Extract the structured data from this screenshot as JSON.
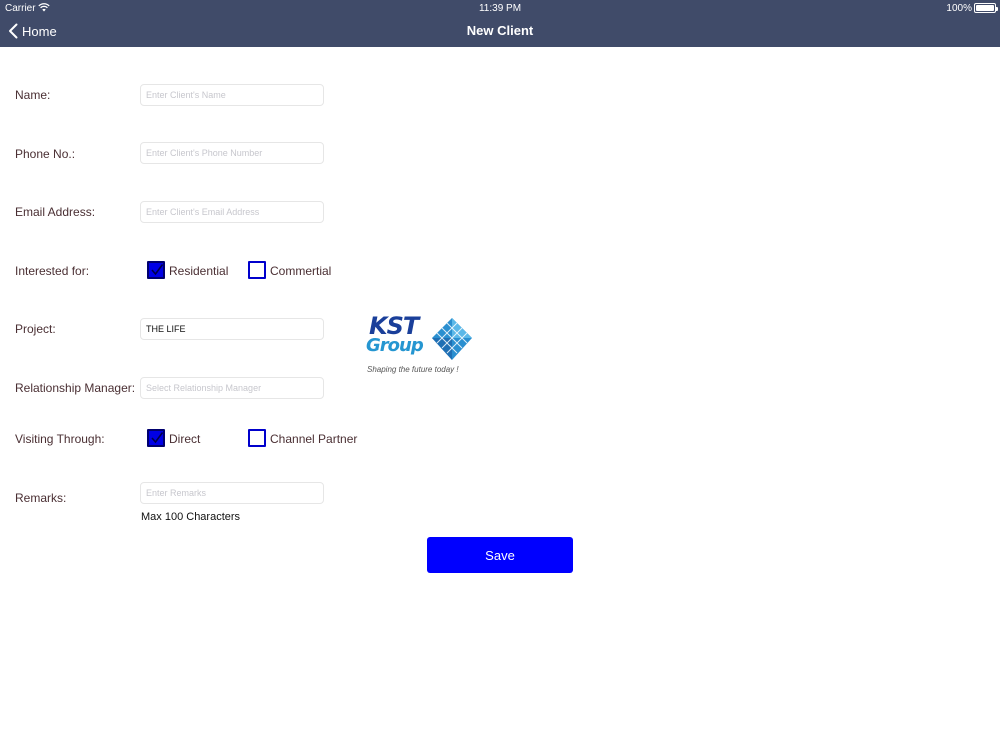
{
  "status_bar": {
    "carrier": "Carrier",
    "time": "11:39 PM",
    "battery": "100%"
  },
  "nav": {
    "back_label": "Home",
    "title": "New Client"
  },
  "form": {
    "name": {
      "label": "Name:",
      "placeholder": "Enter Client's Name",
      "value": ""
    },
    "phone": {
      "label": "Phone No.:",
      "placeholder": "Enter Client's Phone Number",
      "value": ""
    },
    "email": {
      "label": "Email Address:",
      "placeholder": "Enter Client's Email Address",
      "value": ""
    },
    "interested_for": {
      "label": "Interested for:",
      "options": [
        {
          "label": "Residential",
          "checked": true
        },
        {
          "label": "Commertial",
          "checked": false
        }
      ]
    },
    "project": {
      "label": "Project:",
      "placeholder": "",
      "value": "THE LIFE"
    },
    "relationship_manager": {
      "label": "Relationship Manager:",
      "placeholder": "Select Relationship Manager",
      "value": ""
    },
    "visiting_through": {
      "label": "Visiting Through:",
      "options": [
        {
          "label": "Direct",
          "checked": true
        },
        {
          "label": "Channel Partner",
          "checked": false
        }
      ]
    },
    "remarks": {
      "label": "Remarks:",
      "placeholder": "Enter Remarks",
      "value": "",
      "hint": "Max 100 Characters"
    },
    "save_label": "Save"
  },
  "logo": {
    "brand": "KST",
    "group": "Group",
    "tagline": "Shaping the future today !"
  },
  "colors": {
    "nav_background": "#404b69",
    "save_button": "#0000ff",
    "checkbox_checked": "#0000e6",
    "checkbox_border": "#0000cc",
    "label_text": "#4a2f33"
  },
  "icons": {
    "back": "chevron-left-icon",
    "wifi": "wifi-icon",
    "battery": "battery-icon",
    "check": "checkmark-icon",
    "logo_mark": "pyramid-icon"
  }
}
